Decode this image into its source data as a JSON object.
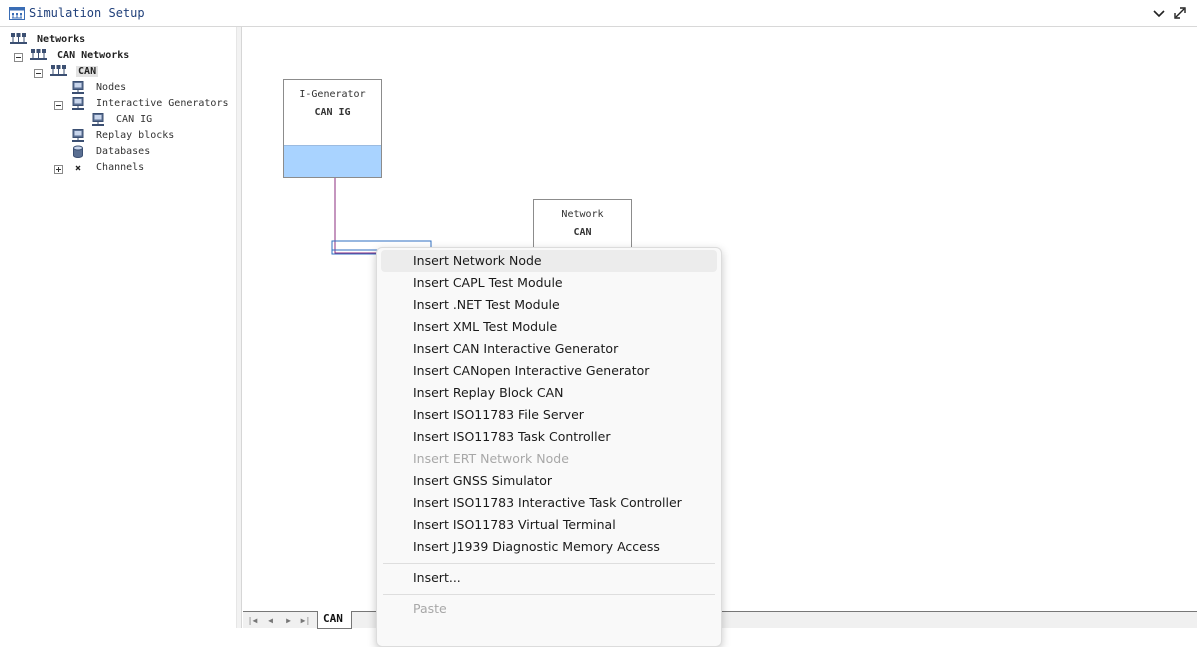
{
  "window": {
    "title": "Simulation Setup"
  },
  "tree": {
    "networks": "Networks",
    "can_networks": "CAN Networks",
    "can": "CAN",
    "nodes": "Nodes",
    "interactive_generators": "Interactive Generators",
    "can_ig": "CAN IG",
    "replay_blocks": "Replay blocks",
    "databases": "Databases",
    "channels": "Channels"
  },
  "blocks": {
    "generator": {
      "type": "I-Generator",
      "name": "CAN IG"
    },
    "network": {
      "type": "Network",
      "name": "CAN"
    }
  },
  "tabs": {
    "active": "CAN"
  },
  "context_menu": {
    "items": [
      {
        "label": "Insert Network Node"
      },
      {
        "label": "Insert CAPL Test Module"
      },
      {
        "label": "Insert .NET Test Module"
      },
      {
        "label": "Insert XML Test Module"
      },
      {
        "label": "Insert CAN Interactive Generator"
      },
      {
        "label": "Insert CANopen Interactive Generator"
      },
      {
        "label": "Insert Replay Block CAN"
      },
      {
        "label": "Insert ISO11783 File Server"
      },
      {
        "label": "Insert ISO11783 Task Controller"
      },
      {
        "label": "Insert ERT Network Node"
      },
      {
        "label": "Insert GNSS Simulator"
      },
      {
        "label": "Insert ISO11783 Interactive Task Controller"
      },
      {
        "label": "Insert ISO11783 Virtual Terminal"
      },
      {
        "label": "Insert J1939 Diagnostic Memory Access"
      }
    ],
    "insert_more": "Insert...",
    "paste": "Paste"
  },
  "colors": {
    "block_fill": "#a9d3ff",
    "connector_purple": "#8b2c7f",
    "connector_blue": "#2f6fc2"
  }
}
